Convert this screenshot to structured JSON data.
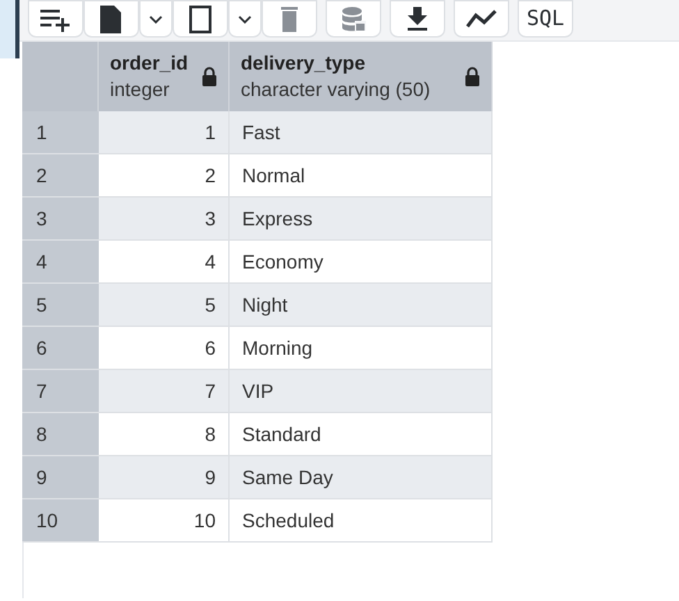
{
  "toolbar": [
    {
      "kind": "icon"
    },
    {
      "kind": "icon"
    },
    {
      "kind": "caret"
    },
    {
      "kind": "icon"
    },
    {
      "kind": "caret"
    },
    {
      "kind": "icon",
      "disabled": true
    },
    {
      "kind": "gap"
    },
    {
      "kind": "icon",
      "disabled": true
    },
    {
      "kind": "gap"
    },
    {
      "kind": "icon"
    },
    {
      "kind": "gap"
    },
    {
      "kind": "icon"
    },
    {
      "kind": "gap"
    },
    {
      "kind": "text",
      "label": "SQL"
    }
  ],
  "table": {
    "columns": [
      {
        "name": "order_id",
        "type": "integer",
        "locked": true
      },
      {
        "name": "delivery_type",
        "type": "character varying (50)",
        "locked": true
      }
    ],
    "rows": [
      {
        "number": "1",
        "cells": [
          "1",
          "Fast"
        ]
      },
      {
        "number": "2",
        "cells": [
          "2",
          "Normal"
        ]
      },
      {
        "number": "3",
        "cells": [
          "3",
          "Express"
        ]
      },
      {
        "number": "4",
        "cells": [
          "4",
          "Economy"
        ]
      },
      {
        "number": "5",
        "cells": [
          "5",
          "Night"
        ]
      },
      {
        "number": "6",
        "cells": [
          "6",
          "Morning"
        ]
      },
      {
        "number": "7",
        "cells": [
          "7",
          "VIP"
        ]
      },
      {
        "number": "8",
        "cells": [
          "8",
          "Standard"
        ]
      },
      {
        "number": "9",
        "cells": [
          "9",
          "Same Day"
        ]
      },
      {
        "number": "10",
        "cells": [
          "10",
          "Scheduled"
        ]
      }
    ]
  }
}
